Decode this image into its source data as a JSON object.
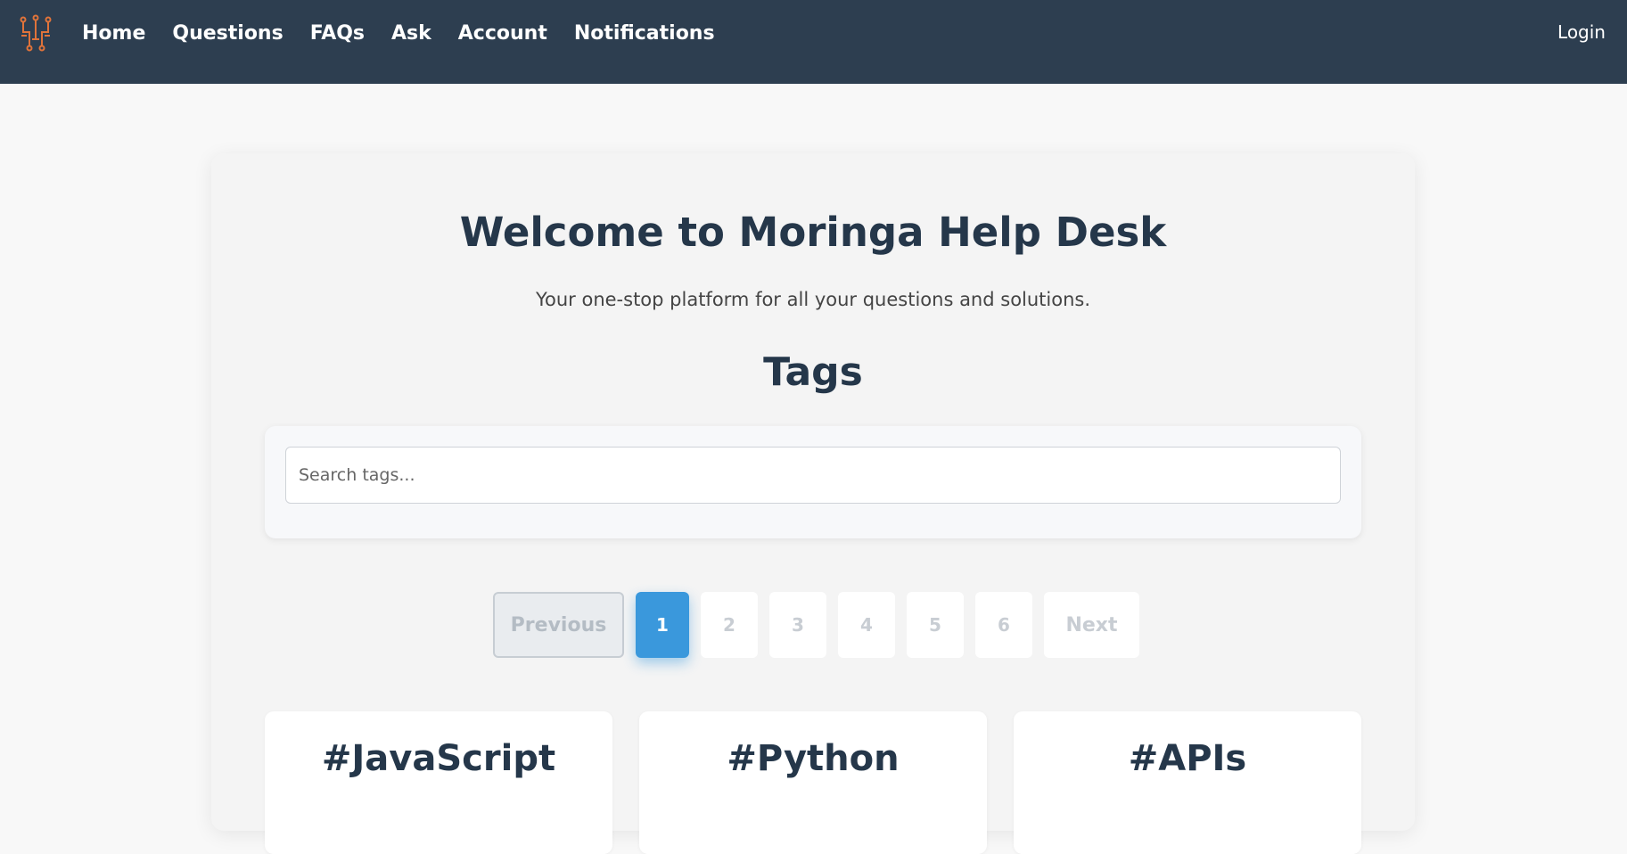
{
  "nav": {
    "items": [
      {
        "label": "Home"
      },
      {
        "label": "Questions"
      },
      {
        "label": "FAQs"
      },
      {
        "label": "Ask"
      },
      {
        "label": "Account"
      },
      {
        "label": "Notifications"
      }
    ],
    "login_label": "Login",
    "logo_icon": "circuit-logo-icon",
    "logo_color": "#e0733a"
  },
  "hero": {
    "title": "Welcome to Moringa Help Desk",
    "subtitle": "Your one-stop platform for all your questions and solutions."
  },
  "tags_section": {
    "heading": "Tags",
    "search": {
      "placeholder": "Search tags...",
      "value": ""
    }
  },
  "pagination": {
    "previous_label": "Previous",
    "pages": [
      "1",
      "2",
      "3",
      "4",
      "5",
      "6"
    ],
    "active_page": "1",
    "next_label": "Next"
  },
  "tags": [
    {
      "name": "#JavaScript"
    },
    {
      "name": "#Python"
    },
    {
      "name": "#APIs"
    }
  ],
  "colors": {
    "navbar": "#2d3e50",
    "accent": "#3a98dc",
    "heading": "#25374a"
  }
}
